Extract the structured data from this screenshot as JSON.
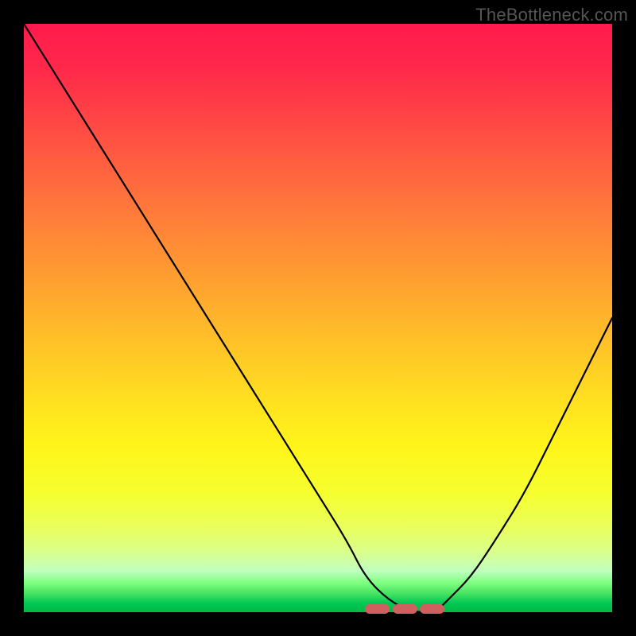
{
  "watermark": "TheBottleneck.com",
  "colors": {
    "background": "#000000",
    "curve": "#000000",
    "marker": "#d06060"
  },
  "chart_data": {
    "type": "line",
    "title": "",
    "xlabel": "",
    "ylabel": "",
    "xlim": [
      0,
      100
    ],
    "ylim": [
      0,
      100
    ],
    "grid": false,
    "annotations": [
      "TheBottleneck.com"
    ],
    "series": [
      {
        "name": "bottleneck-curve",
        "color": "#000000",
        "x": [
          0,
          5,
          10,
          15,
          20,
          25,
          30,
          35,
          40,
          45,
          50,
          55,
          58,
          62,
          66,
          70,
          72,
          76,
          80,
          85,
          90,
          95,
          100
        ],
        "y": [
          100,
          92,
          84,
          76,
          68,
          60,
          52,
          44,
          36,
          28,
          20,
          12,
          6,
          2,
          0,
          0,
          2,
          6,
          12,
          20,
          30,
          40,
          50
        ]
      }
    ],
    "marker_region": {
      "x_start": 58,
      "x_end": 72,
      "y": 0
    },
    "gradient_stops": [
      {
        "pct": 0,
        "color": "#ff1a4d"
      },
      {
        "pct": 50,
        "color": "#ffc020"
      },
      {
        "pct": 80,
        "color": "#fff51a"
      },
      {
        "pct": 100,
        "color": "#00b84a"
      }
    ]
  }
}
